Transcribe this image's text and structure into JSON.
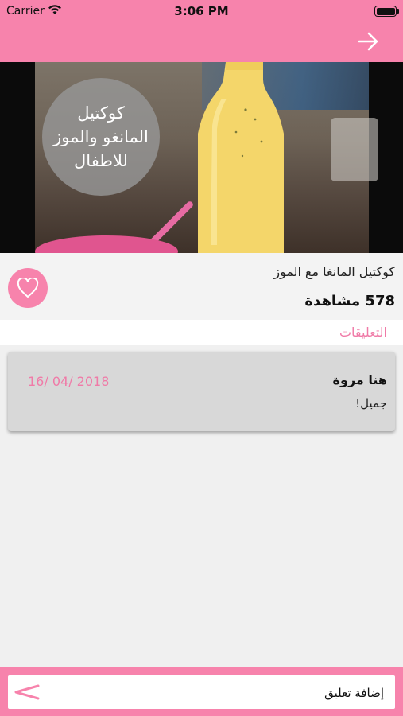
{
  "status_bar": {
    "carrier": "Carrier",
    "time": "3:06 PM"
  },
  "header": {
    "back_icon": "arrow-right-icon",
    "color": "#f783ac"
  },
  "video": {
    "overlay_text": "كوكتيل\nالمانغو والموز\nللاطفال"
  },
  "recipe": {
    "title": "كوكتيل المانغا مع الموز",
    "views": "578 مشاهدة",
    "favorite_icon": "heart-icon"
  },
  "comments": {
    "header": "التعليقات",
    "items": [
      {
        "author": "هنا مروة",
        "text": "جميل!",
        "date": "16/ 04/ 2018"
      }
    ]
  },
  "composer": {
    "placeholder": "إضافة تعليق",
    "send_icon": "send-arrow-icon"
  }
}
